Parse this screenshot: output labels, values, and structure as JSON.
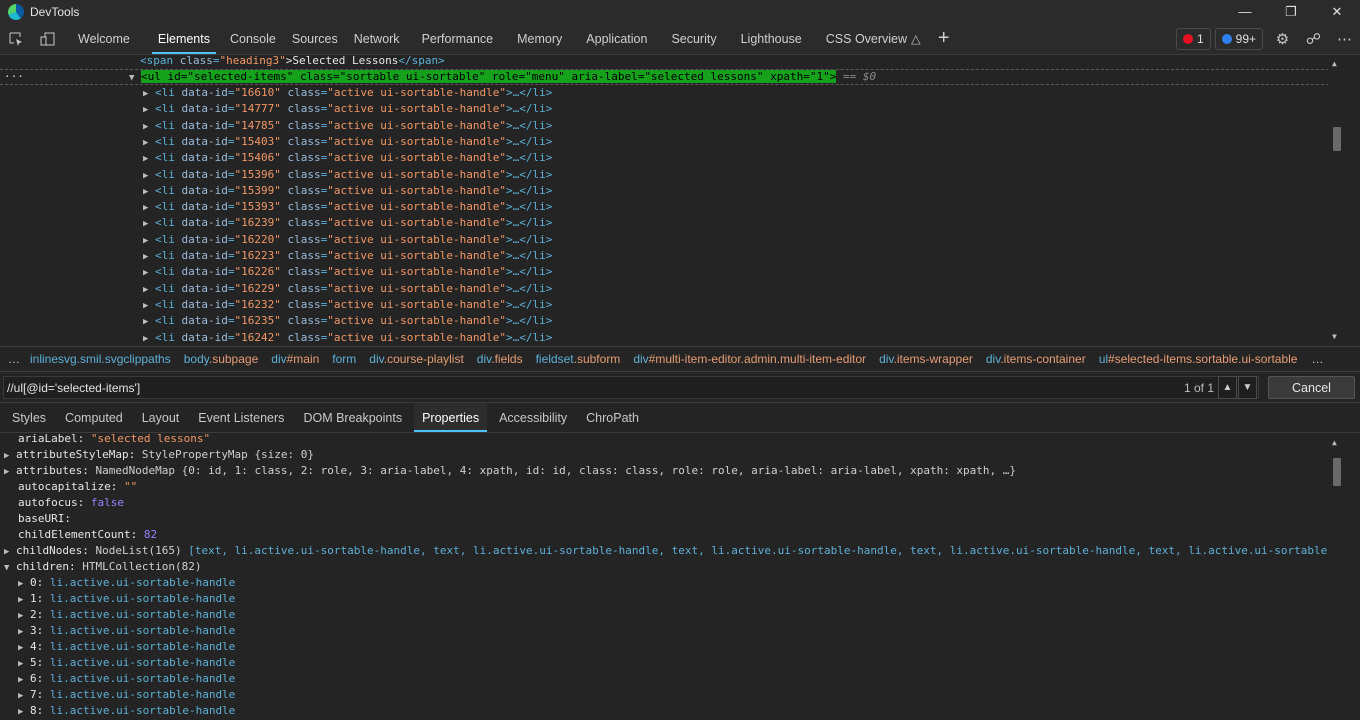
{
  "window": {
    "title": "DevTools"
  },
  "tabs": [
    "Welcome",
    "Elements",
    "Console",
    "Sources",
    "Network",
    "Performance",
    "Memory",
    "Application",
    "Security",
    "Lighthouse",
    "CSS Overview"
  ],
  "active_tab": "Elements",
  "badges": {
    "errors": "1",
    "issues": "99+"
  },
  "dom": {
    "heading_line": {
      "tag_open": "<span",
      "attr": "class",
      "value": "\"heading3\"",
      "text": ">Selected Lessons",
      "tag_close": "</span>"
    },
    "selected_line": "<ul id=\"selected-items\" class=\"sortable ui-sortable\" role=\"menu\" aria-label=\"selected lessons\" xpath=\"1\">",
    "selected_suffix": "== $0",
    "ids": [
      "16610",
      "14777",
      "14785",
      "15403",
      "15406",
      "15396",
      "15399",
      "15393",
      "16239",
      "16220",
      "16223",
      "16226",
      "16229",
      "16232",
      "16235",
      "16242"
    ],
    "li_class": "\"active ui-sortable-handle\"",
    "li_prefix": "<li",
    "li_attr_id": "data-id",
    "li_attr_class": "class",
    "li_suffix": ">…</li>"
  },
  "breadcrumb": [
    {
      "a": "inlinesvg.smil.svgclippaths",
      "b": ""
    },
    {
      "a": "body",
      "b": ".subpage"
    },
    {
      "a": "div",
      "b": "#main"
    },
    {
      "a": "form",
      "b": ""
    },
    {
      "a": "div",
      "b": ".course-playlist"
    },
    {
      "a": "div",
      "b": ".fields"
    },
    {
      "a": "fieldset",
      "b": ".subform"
    },
    {
      "a": "div",
      "b": "#multi-item-editor.admin.multi-item-editor"
    },
    {
      "a": "div",
      "b": ".items-wrapper"
    },
    {
      "a": "div",
      "b": ".items-container"
    },
    {
      "a": "ul",
      "b": "#selected-items.sortable.ui-sortable"
    }
  ],
  "search": {
    "value": "//ul[@id='selected-items']",
    "count": "1 of 1",
    "cancel": "Cancel"
  },
  "subtabs": [
    "Styles",
    "Computed",
    "Layout",
    "Event Listeners",
    "DOM Breakpoints",
    "Properties",
    "Accessibility",
    "ChroPath"
  ],
  "active_subtab": "Properties",
  "properties": {
    "ariaLabel": {
      "key": "ariaLabel:",
      "value": "\"selected lessons\""
    },
    "attributeStyleMap": {
      "key": "attributeStyleMap:",
      "type": "StylePropertyMap",
      "detail": "{size: 0}"
    },
    "attributes": {
      "key": "attributes:",
      "type": "NamedNodeMap",
      "detail": "{0: id, 1: class, 2: role, 3: aria-label, 4: xpath, id: id, class: class, role: role, aria-label: aria-label, xpath: xpath, …}"
    },
    "autocapitalize": {
      "key": "autocapitalize:",
      "value": "\"\""
    },
    "autofocus": {
      "key": "autofocus:",
      "value": "false"
    },
    "baseURI": {
      "key": "baseURI:",
      "value": ""
    },
    "childElementCount": {
      "key": "childElementCount:",
      "value": "82"
    },
    "childNodes": {
      "key": "childNodes:",
      "type": "NodeList(165)",
      "detail": "[text, li.active.ui-sortable-handle, text, li.active.ui-sortable-handle, text, li.active.ui-sortable-handle, text, li.active.ui-sortable-handle, text, li.active.ui-sortable-han"
    },
    "children": {
      "key": "children:",
      "type": "HTMLCollection(82)"
    },
    "child_items": [
      "0:",
      "1:",
      "2:",
      "3:",
      "4:",
      "5:",
      "6:",
      "7:",
      "8:"
    ],
    "child_value": "li.active.ui-sortable-handle"
  }
}
